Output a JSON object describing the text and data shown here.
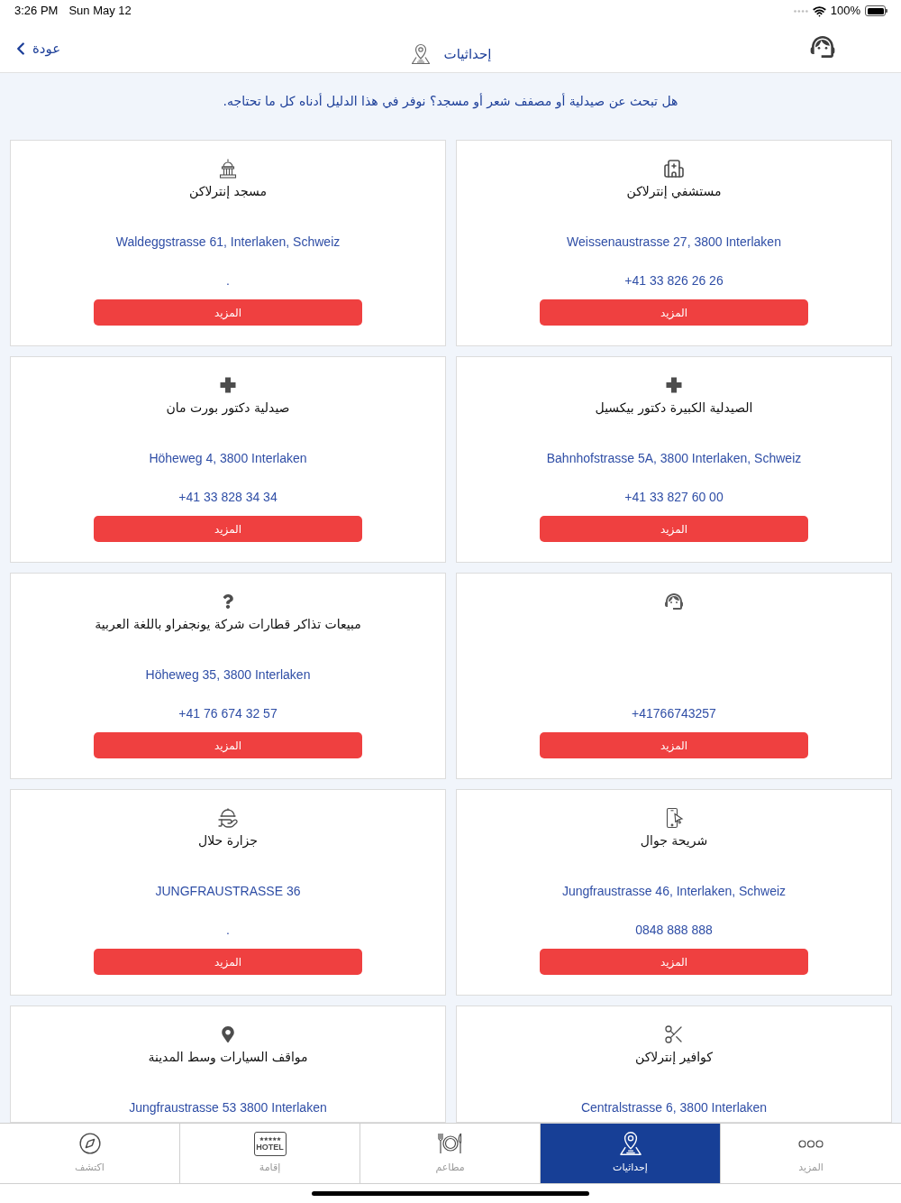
{
  "status_bar": {
    "time": "3:26 PM",
    "date": "Sun May 12",
    "battery": "100%"
  },
  "nav": {
    "back": "عودة",
    "title": "إحداثيات"
  },
  "intro": "هل تبحث عن صيدلية أو مصفف شعر أو مسجد؟ نوفر في هذا الدليل أدناه كل ما تحتاجه.",
  "place_rows": [
    {
      "places": [
        {
          "kind": "hospital",
          "title": "مستشفي إنترلاكن",
          "address": "Weissenaustrasse 27, 3800 Interlaken",
          "phone": "+41 33 826 26 26",
          "button": "المزيد"
        },
        {
          "kind": "mosque",
          "title": "مسجد إنترلاكن",
          "address": "Waldeggstrasse 61, Interlaken, Schweiz",
          "phone": ".",
          "button": "المزيد"
        }
      ]
    },
    {
      "places": [
        {
          "kind": "pharmacy",
          "title": "الصيدلية الكبيرة دكتور بيكسيل",
          "address": "Bahnhofstrasse 5A, 3800 Interlaken, Schweiz",
          "phone": "+41 33 827 60 00",
          "button": "المزيد"
        },
        {
          "kind": "pharmacy",
          "title": "صيدلية دكتور بورت مان",
          "address": "Höheweg 4, 3800 Interlaken",
          "phone": "+41 33 828 34 34",
          "button": "المزيد"
        }
      ]
    },
    {
      "places": [
        {
          "kind": "support",
          "phone": "+41766743257",
          "button": "المزيد"
        },
        {
          "kind": "info",
          "title": "مبيعات تذاكر قطارات شركة يونجفراو باللغة العربية",
          "address": "Höheweg 35, 3800 Interlaken",
          "phone": "+41 76 674 32 57",
          "button": "المزيد"
        }
      ]
    },
    {
      "places": [
        {
          "kind": "sim",
          "title": "شريحة جوال",
          "address": "Jungfraustrasse 46, Interlaken, Schweiz",
          "phone": "0848 888 888",
          "button": "المزيد"
        },
        {
          "kind": "butcher",
          "title": "جزارة حلال",
          "address": "JUNGFRAUSTRASSE 36",
          "phone": ".",
          "button": "المزيد"
        }
      ]
    },
    {
      "places": [
        {
          "kind": "hairdresser",
          "title": "كوافير إنترلاكن",
          "address": "Centralstrasse 6, 3800 Interlaken"
        },
        {
          "kind": "parking",
          "title": "مواقف السيارات وسط المدينة",
          "address": "Jungfraustrasse 53 3800 Interlaken"
        }
      ]
    }
  ],
  "tabs": [
    {
      "kind": "more",
      "label": "المزيد",
      "selected": false
    },
    {
      "kind": "location",
      "label": "إحداثيات",
      "selected": true
    },
    {
      "kind": "dining",
      "label": "مطاعم",
      "selected": false
    },
    {
      "kind": "hotel",
      "label": "إقامة",
      "sign": "HOTEL",
      "selected": false
    },
    {
      "kind": "discover",
      "label": "اكتشف",
      "selected": false
    }
  ]
}
